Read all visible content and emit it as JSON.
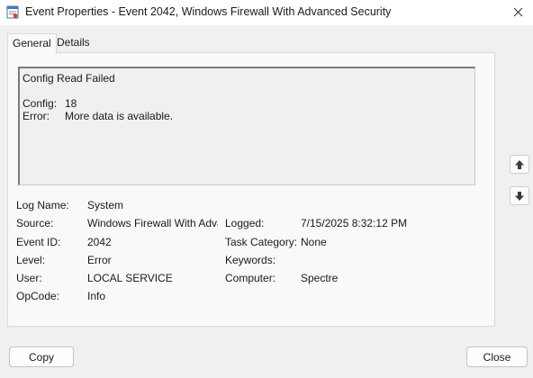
{
  "window": {
    "title": "Event Properties - Event 2042, Windows Firewall With Advanced Security",
    "icon": "event-viewer-icon"
  },
  "tabs": [
    {
      "label": "General"
    },
    {
      "label": "Details"
    }
  ],
  "description": {
    "line1": "Config Read Failed",
    "config_label": "Config:",
    "config_value": "18",
    "error_label": "Error:",
    "error_value": "More data is available."
  },
  "fields": {
    "log_name_label": "Log Name:",
    "log_name_value": "System",
    "source_label": "Source:",
    "source_value": "Windows Firewall With Adva",
    "logged_label": "Logged:",
    "logged_value": "7/15/2025 8:32:12 PM",
    "event_id_label": "Event ID:",
    "event_id_value": "2042",
    "task_category_label": "Task Category:",
    "task_category_value": "None",
    "level_label": "Level:",
    "level_value": "Error",
    "keywords_label": "Keywords:",
    "keywords_value": "",
    "user_label": "User:",
    "user_value": "LOCAL SERVICE",
    "computer_label": "Computer:",
    "computer_value": "Spectre",
    "opcode_label": "OpCode:",
    "opcode_value": "Info"
  },
  "nav": {
    "up_icon": "arrow-up-icon",
    "down_icon": "arrow-down-icon"
  },
  "buttons": {
    "copy": "Copy",
    "close": "Close"
  },
  "colors": {
    "background": "#f0f0f0",
    "titlebar": "#ffffff",
    "panel": "#f9f9f9"
  }
}
